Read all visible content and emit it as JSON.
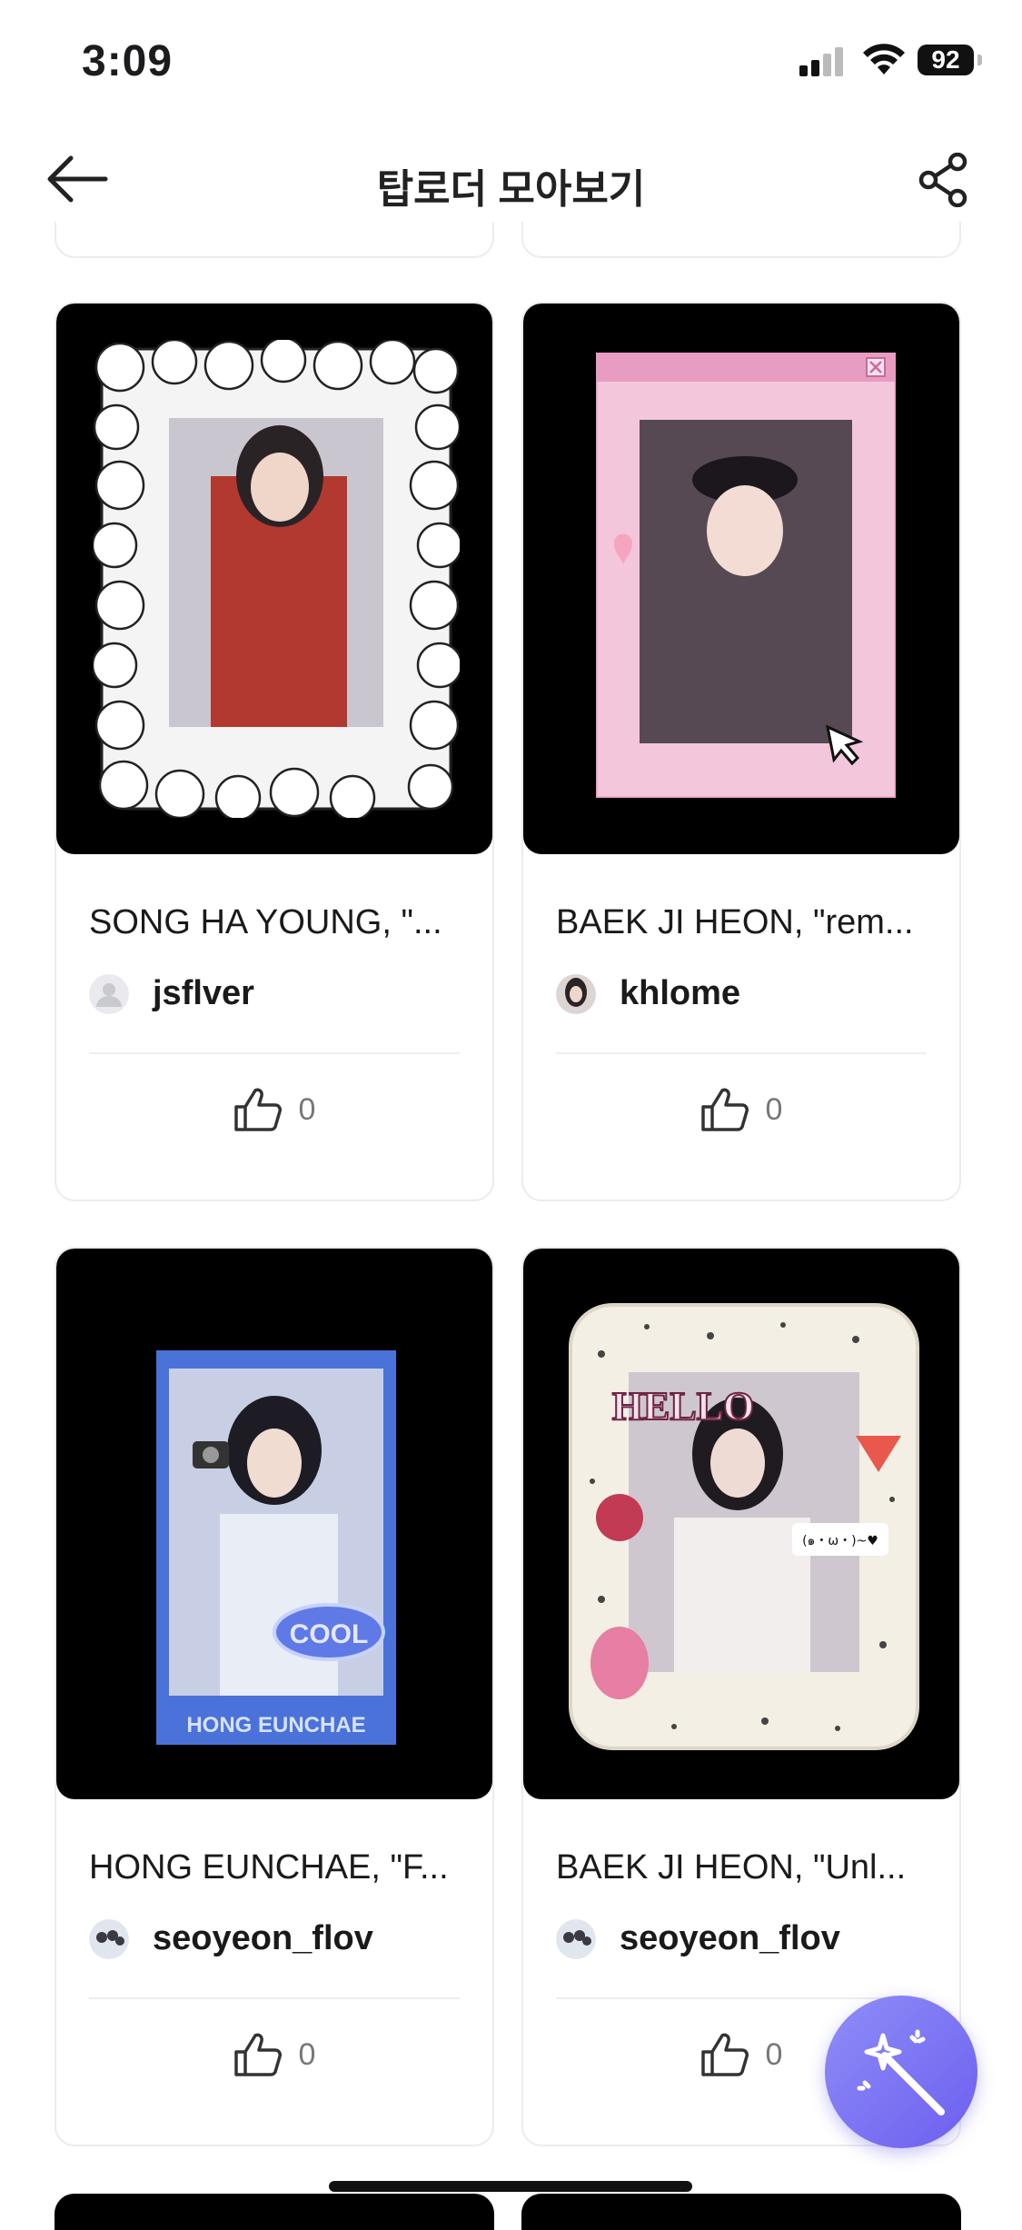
{
  "status_bar": {
    "time": "3:09",
    "battery": "92"
  },
  "nav": {
    "title": "탑로더 모아보기"
  },
  "cards": [
    {
      "name": "SONG HA YOUNG, \"...",
      "user": "jsflver",
      "likes": "0",
      "avatar": "default-avatar",
      "frame": "white-flower-frame"
    },
    {
      "name": "BAEK JI HEON, \"rem...",
      "user": "khlome",
      "likes": "0",
      "avatar": "photo-avatar",
      "frame": "pink-window-frame"
    },
    {
      "name": "HONG EUNCHAE, \"F...",
      "user": "seoyeon_flov",
      "likes": "0",
      "avatar": "photo-avatar",
      "frame": "blue-sticker-frame",
      "frame_text": [
        "COOL",
        "HONG EUNCHAE"
      ]
    },
    {
      "name": "BAEK JI HEON, \"Unl...",
      "user": "seoyeon_flov",
      "likes": "0",
      "avatar": "photo-avatar",
      "frame": "cream-frame",
      "frame_text": [
        "HELLO",
        "(๑・ω・)~♥"
      ]
    }
  ],
  "colors": {
    "accent_fab": "#7b6ef2",
    "card_border": "#ececec",
    "thumb_bg": "#000000",
    "pink_frame": "#f3c6dc"
  },
  "fab": {
    "icon": "magic-wand-icon"
  }
}
